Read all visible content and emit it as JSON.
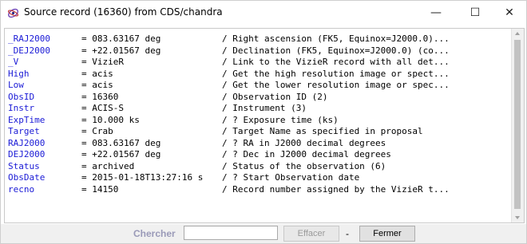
{
  "window": {
    "title": "Source record (16360) from CDS/chandra",
    "minimize": "—",
    "maximize": "☐",
    "close": "✕"
  },
  "record": {
    "rows": [
      {
        "name": "_RAJ2000",
        "value": "= 083.63167 deg",
        "desc": "/ Right ascension (FK5, Equinox=J2000.0)..."
      },
      {
        "name": "_DEJ2000",
        "value": "= +22.01567 deg",
        "desc": "/ Declination (FK5, Equinox=J2000.0) (co..."
      },
      {
        "name": "_V",
        "value": "= VizieR",
        "desc": "/ Link to the VizieR record with all det..."
      },
      {
        "name": "High",
        "value": "= acis",
        "desc": "/ Get the high resolution image or spect..."
      },
      {
        "name": "Low",
        "value": "= acis",
        "desc": "/ Get the lower resolution image or spec..."
      },
      {
        "name": "ObsID",
        "value": "= 16360",
        "desc": "/ Observation ID (2)"
      },
      {
        "name": "Instr",
        "value": "= ACIS-S",
        "desc": "/ Instrument (3)"
      },
      {
        "name": "ExpTime",
        "value": "= 10.000 ks",
        "desc": "/ ? Exposure time (ks)"
      },
      {
        "name": "Target",
        "value": "= Crab",
        "desc": "/ Target Name as specified in proposal"
      },
      {
        "name": "RAJ2000",
        "value": "= 083.63167 deg",
        "desc": "/ ? RA in J2000 decimal degrees"
      },
      {
        "name": "DEJ2000",
        "value": "= +22.01567 deg",
        "desc": "/ ? Dec in J2000 decimal degrees"
      },
      {
        "name": "Status",
        "value": "= archived",
        "desc": "/ Status of the observation (6)"
      },
      {
        "name": "ObsDate",
        "value": "= 2015-01-18T13:27:16 s",
        "desc": "/ ? Start Observation date"
      },
      {
        "name": "recno",
        "value": "= 14150",
        "desc": "/ Record number assigned by the VizieR t..."
      }
    ]
  },
  "footer": {
    "search_label": "Chercher",
    "search_value": "",
    "clear_label": "Effacer",
    "separator": "-",
    "close_label": "Fermer"
  },
  "colors": {
    "field_name": "#1a1ad6",
    "search_label": "#9a9ab8"
  },
  "icons": {
    "app": "aladin-icon",
    "scroll_up": "arrow-up-icon",
    "scroll_down": "arrow-down-icon"
  }
}
